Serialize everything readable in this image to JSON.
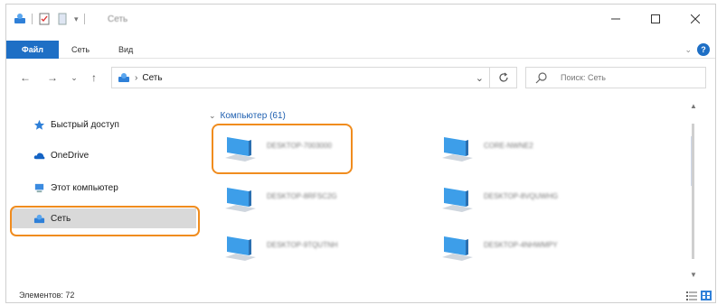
{
  "window": {
    "title": "Сеть",
    "controls": {
      "minimize": "—",
      "maximize": "☐",
      "close": "✕"
    }
  },
  "ribbon": {
    "tabs": [
      {
        "label": "Файл"
      },
      {
        "label": "Сеть"
      },
      {
        "label": "Вид"
      }
    ]
  },
  "address": {
    "breadcrumb": "Сеть",
    "search_placeholder": "Поиск: Сеть"
  },
  "sidebar": {
    "items": [
      {
        "label": "Быстрый доступ",
        "icon": "star-icon"
      },
      {
        "label": "OneDrive",
        "icon": "cloud-icon"
      },
      {
        "label": "Этот компьютер",
        "icon": "computer-icon"
      },
      {
        "label": "Сеть",
        "icon": "network-icon",
        "selected": true
      }
    ]
  },
  "content": {
    "group_label": "Компьютер (61)",
    "items": [
      {
        "name": "DESKTOP-7003000"
      },
      {
        "name": "CORE-NWNE2"
      },
      {
        "name": "DESKTOP-8RFSC2G"
      },
      {
        "name": "DESKTOP-8VQUWHG"
      },
      {
        "name": "DESKTOP-9TQUTNH"
      },
      {
        "name": "DESKTOP-4NHWMPY"
      }
    ]
  },
  "status": {
    "count": "Элементов: 72"
  },
  "colors": {
    "accent": "#1e6fc5",
    "highlight": "#f08c1e",
    "selected_bg": "#d9d9d9"
  }
}
